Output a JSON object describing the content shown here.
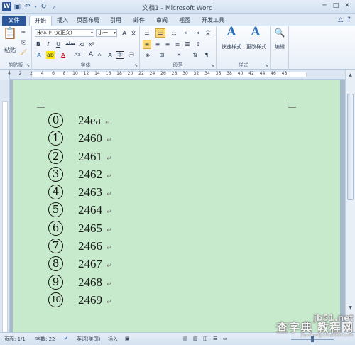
{
  "window": {
    "title": "文档1 - Microsoft Word",
    "app_icon": "W",
    "qat_icons": [
      "save-icon",
      "undo-icon",
      "undo-dropdown-icon",
      "redo-icon",
      "customize-qat-icon"
    ],
    "controls": [
      "─",
      "□",
      "✕"
    ]
  },
  "tabs": {
    "file": "文件",
    "items": [
      "开始",
      "插入",
      "页面布局",
      "引用",
      "邮件",
      "审阅",
      "视图",
      "开发工具"
    ],
    "active_index": 0
  },
  "ribbon": {
    "clipboard": {
      "paste": "粘贴",
      "label": "剪贴板"
    },
    "font": {
      "font_name": "宋体 (中文正文)",
      "font_size": "小一",
      "bold": "B",
      "italic": "I",
      "underline": "U",
      "strike": "abe",
      "subscript": "x₂",
      "superscript": "x²",
      "grow": "A",
      "shrink": "A",
      "case": "Aa",
      "label": "字体"
    },
    "paragraph": {
      "label": "段落"
    },
    "styles": {
      "quick_styles": "快速样式",
      "change_styles": "更改样式",
      "label": "样式"
    },
    "editing": {
      "label": "编辑"
    }
  },
  "ruler": {
    "numbers": [
      "4",
      "2",
      "2",
      "4",
      "6",
      "8",
      "10",
      "12",
      "14",
      "16",
      "18",
      "20",
      "22",
      "24",
      "26",
      "28",
      "30",
      "32",
      "34",
      "36",
      "38",
      "40",
      "42",
      "44",
      "46",
      "48"
    ]
  },
  "document": {
    "page_color": "#c7e9cc",
    "paragraph_mark": "↵",
    "rows": [
      {
        "symbol": "⓪",
        "value": "24ea"
      },
      {
        "symbol": "①",
        "value": "2460"
      },
      {
        "symbol": "②",
        "value": "2461"
      },
      {
        "symbol": "③",
        "value": "2462"
      },
      {
        "symbol": "④",
        "value": "2463"
      },
      {
        "symbol": "⑤",
        "value": "2464"
      },
      {
        "symbol": "⑥",
        "value": "2465"
      },
      {
        "symbol": "⑦",
        "value": "2466"
      },
      {
        "symbol": "⑧",
        "value": "2467"
      },
      {
        "symbol": "⑨",
        "value": "2468"
      },
      {
        "symbol": "⑩",
        "value": "2469"
      }
    ]
  },
  "statusbar": {
    "page": "页面: 1/1",
    "words": "字数: 22",
    "language": "英语(美国)",
    "insert_mode": "插入"
  },
  "watermark": {
    "line1": "jb51.net",
    "line2": "查字典 教程网",
    "line3": "jiaocheng.chazidian.com"
  }
}
